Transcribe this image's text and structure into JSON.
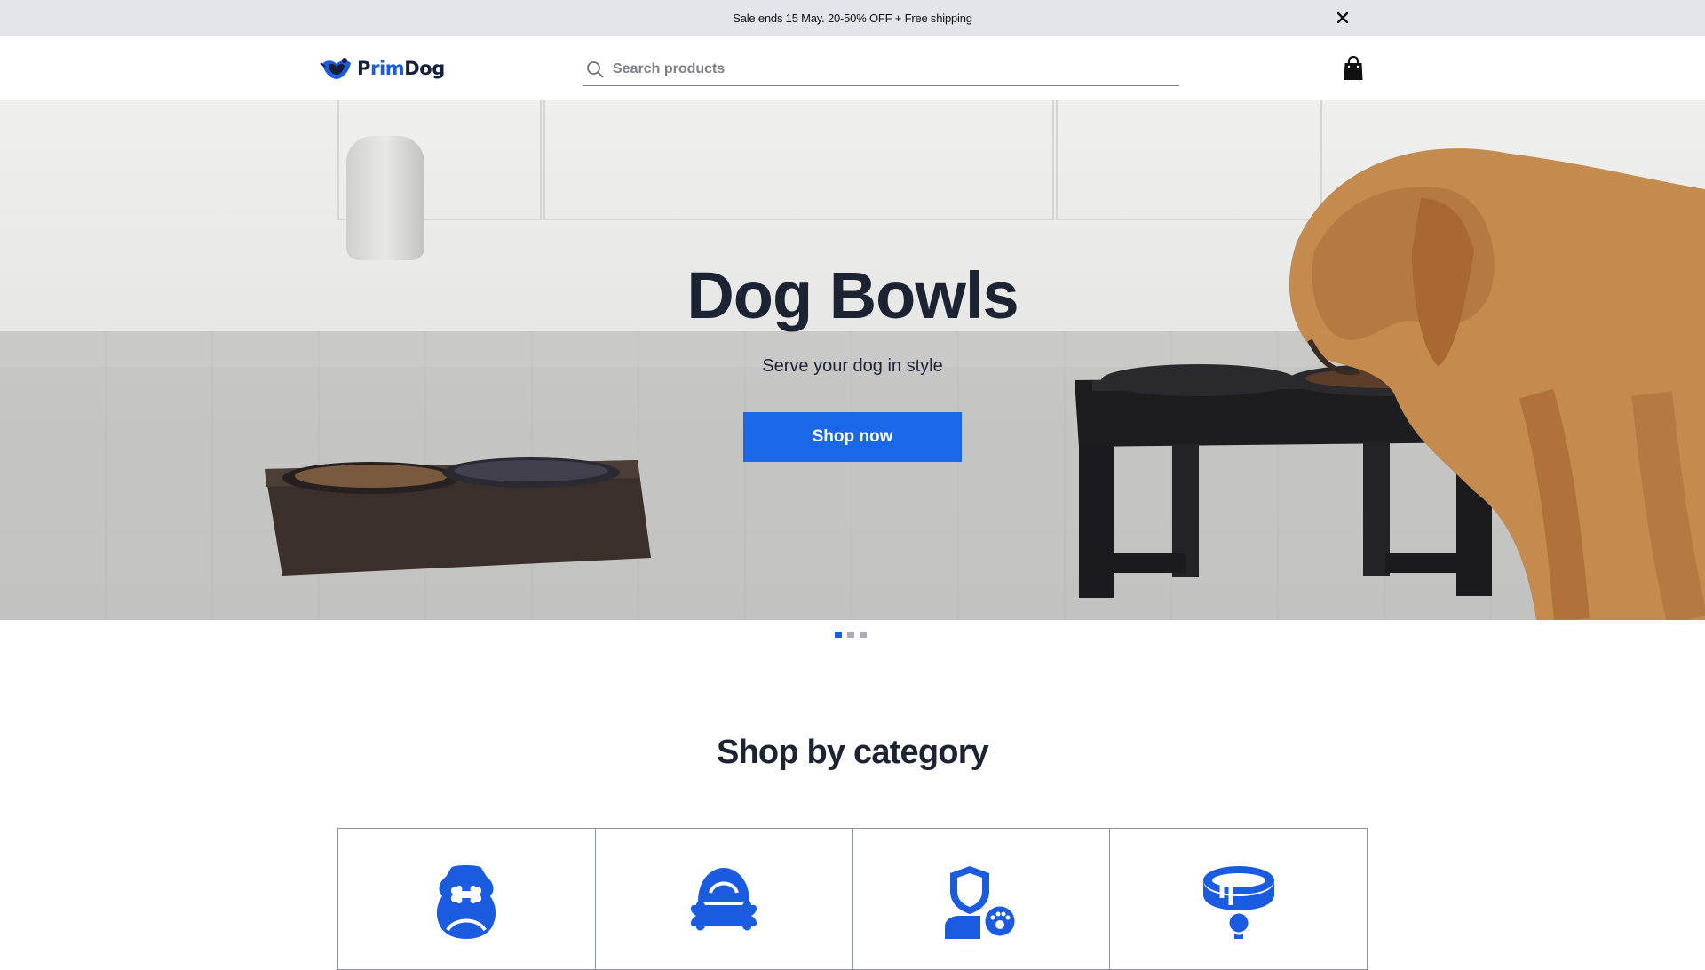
{
  "announcement": {
    "text": "Sale ends 15 May. 20-50% OFF + Free shipping",
    "close_icon": "close-icon"
  },
  "header": {
    "logo_prefix": "P",
    "logo_accent": "rim",
    "logo_suffix": "Dog",
    "search_placeholder": "Search products",
    "cart_icon": "shopping-bag-icon"
  },
  "hero": {
    "title": "Dog Bowls",
    "subtitle": "Serve your dog in style",
    "cta_label": "Shop now",
    "slides_total": 3,
    "active_slide": 1
  },
  "categories": {
    "title": "Shop by category",
    "items": [
      {
        "icon": "dog-treat-bone-icon"
      },
      {
        "icon": "dog-bed-bone-icon"
      },
      {
        "icon": "pet-health-shield-icon"
      },
      {
        "icon": "dog-collar-tag-icon"
      }
    ]
  },
  "colors": {
    "accent": "#1a68e8",
    "text": "#1c2333",
    "announcement_bg": "#e2e5ea"
  }
}
